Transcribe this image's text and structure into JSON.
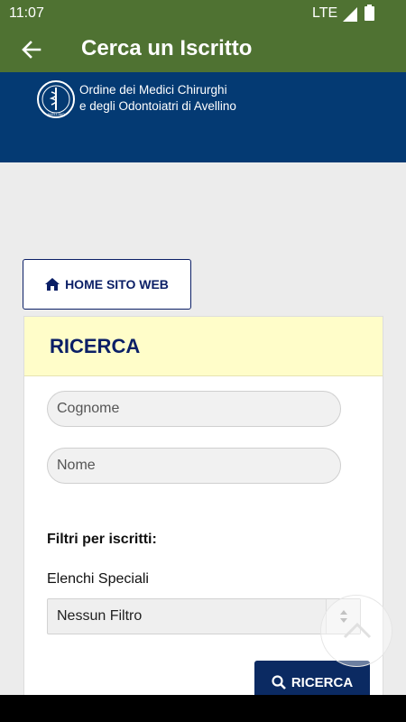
{
  "status": {
    "time": "11:07",
    "network": "LTE"
  },
  "appbar": {
    "title": "Cerca un Iscritto",
    "back_icon": "arrow-back-icon"
  },
  "banner": {
    "org_line1": "Ordine dei Medici Chirurghi",
    "org_line2": "e degli Odontoiatri di Avellino",
    "logo_text": "AVELLINO"
  },
  "home_button": {
    "label": "HOME SITO WEB",
    "icon": "home-icon"
  },
  "search_card": {
    "title": "RICERCA",
    "cognome_placeholder": "Cognome",
    "nome_placeholder": "Nome",
    "filters_heading": "Filtri per iscritti:",
    "special_lists_label": "Elenchi Speciali",
    "special_lists_value": "Nessun Filtro",
    "search_button_label": "RICERCA"
  },
  "colors": {
    "appbar": "#4f7232",
    "banner": "#043a73",
    "navy": "#0b1f66",
    "card_header": "#fffdc9"
  }
}
